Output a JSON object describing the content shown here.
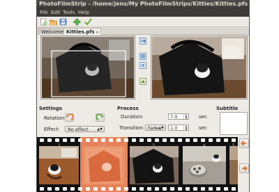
{
  "window": {
    "title": "PhotoFilmStrip - /home/jens/My PhotoFilmStrips/Kitties/Kitties.pfs",
    "controls": [
      "close",
      "minimize",
      "maximize"
    ]
  },
  "menu": [
    "File",
    "Edit",
    "Tools",
    "Help"
  ],
  "toolbar": {
    "buttons": [
      {
        "name": "new-project-icon",
        "color": "#7bb661"
      },
      {
        "name": "open-project-icon",
        "color": "#e8a040"
      },
      {
        "name": "save-project-icon",
        "color": "#5b8ec9"
      },
      {
        "name": "add-pictures-icon",
        "color": "#5db84a"
      },
      {
        "name": "render-filmstrip-icon",
        "color": "#6aab3d"
      }
    ]
  },
  "tabs": [
    {
      "label": "Welcome",
      "active": false
    },
    {
      "label": "Kitties.pfs",
      "close": "x",
      "active": true
    }
  ],
  "settings": {
    "heading": "Settings",
    "rotation_label": "Rotation:",
    "effect_label": "Effect:",
    "effect_value": "No effect"
  },
  "process": {
    "heading": "Process",
    "duration_label": "Duration:",
    "duration_value": "7.0",
    "duration_unit": "sec",
    "transition_label": "Transition:",
    "transition_value": "Fade",
    "transition_duration": "1.0",
    "transition_unit": "sec"
  },
  "subtitle": {
    "heading": "Subtitle"
  },
  "filmstrip": {
    "frames": [
      {
        "number": "1",
        "selected": false
      },
      {
        "number": "2",
        "selected": true
      },
      {
        "number": "3",
        "selected": false
      },
      {
        "number": "4",
        "selected": false
      },
      {
        "number": "5",
        "selected": false
      }
    ]
  },
  "colors": {
    "selected_frame": "#e8825a",
    "accent_orange": "#e07a3c",
    "accent_green": "#58a83c"
  }
}
